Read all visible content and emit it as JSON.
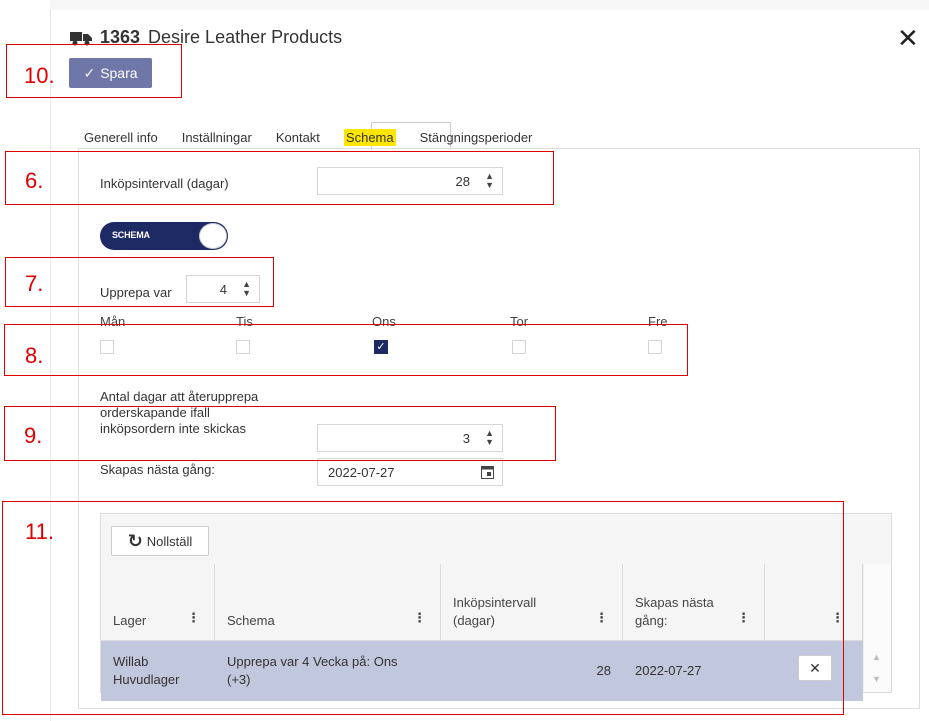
{
  "dialog": {
    "vendor_number": "1363",
    "vendor_name": "Desire Leather Products",
    "close_symbol": "✕",
    "truck_icon": "truck-icon"
  },
  "toolbar": {
    "save_label": "Spara",
    "save_icon": "checkmark-icon"
  },
  "tabs": [
    {
      "label": "Generell info"
    },
    {
      "label": "Inställningar"
    },
    {
      "label": "Kontakt"
    },
    {
      "label": "Schema",
      "active": true
    },
    {
      "label": "Stängningsperioder"
    }
  ],
  "form": {
    "interval_label": "Inköpsintervall (dagar)",
    "interval_value": "28",
    "toggle_label": "SCHEMA",
    "repeat_label": "Upprepa var",
    "repeat_value": "4",
    "days": [
      {
        "label": "Mån",
        "checked": false
      },
      {
        "label": "Tis",
        "checked": false
      },
      {
        "label": "Ons",
        "checked": true
      },
      {
        "label": "Tor",
        "checked": false
      },
      {
        "label": "Fre",
        "checked": false
      }
    ],
    "retry_label_1": "Antal dagar att återupprepa",
    "retry_label_2": "orderskapande ifall",
    "retry_label_3": "inköpsordern inte skickas",
    "retry_value": "3",
    "next_label": "Skapas nästa gång:",
    "next_value": "2022-07-27"
  },
  "grid": {
    "reset_label": "Nollställ",
    "columns": [
      {
        "line1": "Lager",
        "line2": ""
      },
      {
        "line1": "Schema",
        "line2": ""
      },
      {
        "line1": "Inköpsintervall",
        "line2": "(dagar)"
      },
      {
        "line1": "Skapas nästa",
        "line2": "gång:"
      }
    ],
    "rows": [
      {
        "lager_1": "Willab",
        "lager_2": "Huvudlager",
        "schema_1": "Upprepa var 4 Vecka på: Ons",
        "schema_2": "(+3)",
        "interval": "28",
        "next": "2022-07-27"
      }
    ],
    "delete_symbol": "✕"
  },
  "annotations": [
    "10.",
    "6.",
    "7.",
    "8.",
    "9.",
    "11."
  ],
  "colors": {
    "primary": "#1d2a63",
    "save_button": "#6e77a8",
    "row_selected": "#c1c7dd",
    "highlight": "#ffe600",
    "annotation": "#e00000"
  }
}
